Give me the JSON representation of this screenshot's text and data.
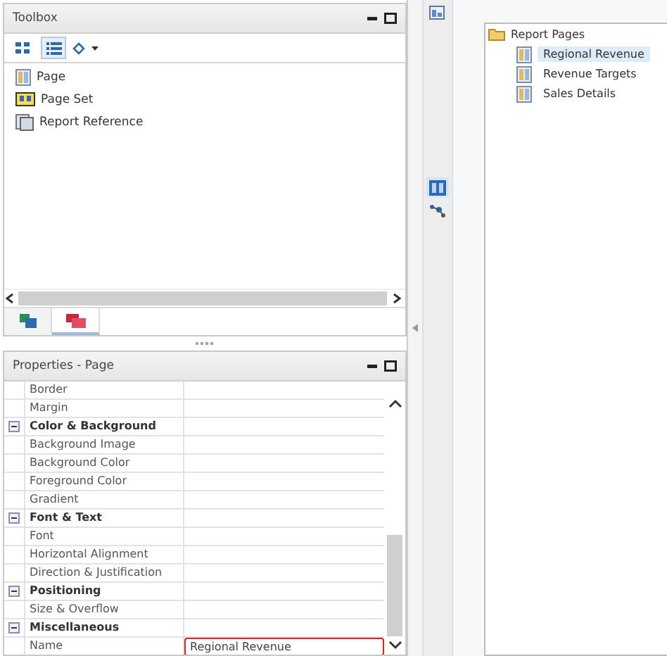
{
  "toolbox": {
    "title": "Toolbox",
    "view_buttons": [
      {
        "kind": "grid",
        "selected": false
      },
      {
        "kind": "list",
        "selected": true
      }
    ],
    "items": [
      {
        "label": "Page",
        "kind": "page"
      },
      {
        "label": "Page Set",
        "kind": "pageset"
      },
      {
        "label": "Report Reference",
        "kind": "reference"
      }
    ],
    "tabs": [
      {
        "kind": "tree",
        "selected": false
      },
      {
        "kind": "pages",
        "selected": true
      }
    ]
  },
  "properties": {
    "title": "Properties -  Page",
    "rows": [
      {
        "kind": "property",
        "label": "Border"
      },
      {
        "kind": "property",
        "label": "Margin"
      },
      {
        "kind": "group",
        "label": "Color & Background",
        "expanded": true
      },
      {
        "kind": "property",
        "label": "Background Image"
      },
      {
        "kind": "property",
        "label": "Background Color"
      },
      {
        "kind": "property",
        "label": "Foreground Color"
      },
      {
        "kind": "property",
        "label": "Gradient"
      },
      {
        "kind": "group",
        "label": "Font & Text",
        "expanded": true
      },
      {
        "kind": "property",
        "label": "Font"
      },
      {
        "kind": "property",
        "label": "Horizontal Alignment"
      },
      {
        "kind": "property",
        "label": "Direction & Justification"
      },
      {
        "kind": "group",
        "label": "Positioning",
        "expanded": true
      },
      {
        "kind": "property",
        "label": "Size & Overflow"
      },
      {
        "kind": "group",
        "label": "Miscellaneous",
        "expanded": true
      },
      {
        "kind": "property",
        "label": "Name",
        "value": "Regional Revenue",
        "focused": true
      }
    ]
  },
  "strip": {
    "buttons": [
      {
        "kind": "explorer",
        "selected": false
      },
      {
        "kind": "pages",
        "selected": true
      },
      {
        "kind": "diagram",
        "selected": false
      }
    ]
  },
  "report_pages": {
    "title": "Report Pages",
    "items": [
      {
        "label": "Regional Revenue",
        "selected": true
      },
      {
        "label": "Revenue Targets",
        "selected": false
      },
      {
        "label": "Sales Details",
        "selected": false
      }
    ]
  }
}
